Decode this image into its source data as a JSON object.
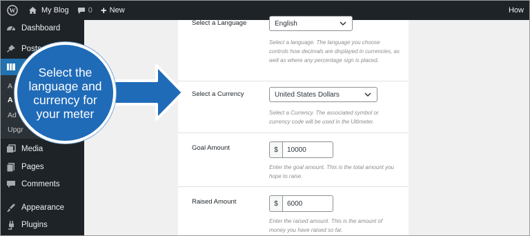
{
  "adminbar": {
    "site_name": "My Blog",
    "comments_count": "0",
    "new_label": "New",
    "howdy": "How"
  },
  "sidebar": {
    "items": [
      {
        "label": "Dashboard",
        "icon": "dashboard-icon"
      },
      {
        "label": "Posts",
        "icon": "pin-icon"
      },
      {
        "label": "",
        "icon": "plugin-menu-icon"
      },
      {
        "label": "Media",
        "icon": "media-icon"
      },
      {
        "label": "Pages",
        "icon": "pages-icon"
      },
      {
        "label": "Comments",
        "icon": "comments-icon"
      },
      {
        "label": "Appearance",
        "icon": "appearance-icon"
      },
      {
        "label": "Plugins",
        "icon": "plugins-icon"
      }
    ],
    "submenu": [
      "A",
      "A",
      "Ad",
      "Upgr"
    ]
  },
  "form": {
    "language": {
      "label": "Select a Language",
      "value": "English",
      "description": "Select a language. The language you choose controls how decimals are displayed in currencies, as well as where any percentage sign is placed."
    },
    "currency": {
      "label": "Select a Currency",
      "value": "United States Dollars",
      "description": "Select a Currency. The associated symbol or currency code will be used in the Ultimeter."
    },
    "goal": {
      "label": "Goal Amount",
      "symbol": "$",
      "value": "10000",
      "description": "Enter the goal amount. This is the total amount you hope to raise."
    },
    "raised": {
      "label": "Raised Amount",
      "symbol": "$",
      "value": "6000",
      "description": "Enter the raised amount. This is the amount of money you have raised so far."
    }
  },
  "callout": {
    "text": "Select the language and currency for your meter"
  },
  "colors": {
    "adminbar": "#1d2327",
    "accent": "#2271b1",
    "callout": "#1f6bb8"
  }
}
